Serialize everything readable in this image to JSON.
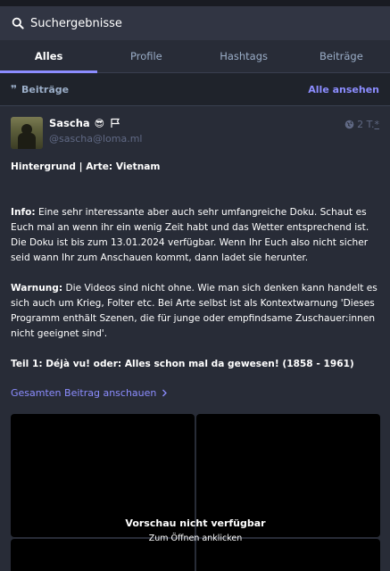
{
  "search": {
    "value": "Suchergebnisse"
  },
  "tabs": [
    {
      "label": "Alles",
      "active": true
    },
    {
      "label": "Profile",
      "active": false
    },
    {
      "label": "Hashtags",
      "active": false
    },
    {
      "label": "Beiträge",
      "active": false
    }
  ],
  "section": {
    "title": "Beiträge",
    "view_all": "Alle ansehen"
  },
  "post": {
    "display_name": "Sascha",
    "emoji": "😎",
    "acct": "@sascha@loma.ml",
    "time": "2 T.",
    "time_marker": "*",
    "title": "Hintergrund | Arte: Vietnam",
    "info_label": "Info:",
    "info_text": " Eine sehr interessante aber auch sehr umfangreiche Doku. Schaut es Euch mal an wenn ihr ein wenig Zeit habt und das Wetter entsprechend ist. Die Doku ist bis zum 13.01.2024 verfügbar. Wenn Ihr Euch also nicht sicher seid wann Ihr zum Anschauen kommt, dann ladet sie herunter.",
    "warning_label": "Warnung:",
    "warning_text": " Die Videos sind nicht ohne. Wie man sich denken kann handelt es sich auch um Krieg, Folter etc. Bei Arte selbst ist als Kontextwarnung 'Dieses Programm enthält Szenen, die für junge oder empfindsame Zuschauer:innen nicht geeignet sind'.",
    "part1": "Teil 1: Déjà vu! oder: Alles schon mal da gewesen! (1858 - 1961)",
    "read_more": "Gesamten Beitrag anschauen",
    "media": {
      "unavailable": "Vorschau nicht verfügbar",
      "click_hint": "Zum Öffnen anklicken"
    }
  },
  "colors": {
    "background": "#282c37",
    "accent": "#8c8dff",
    "muted": "#606984",
    "secondary": "#9baec8"
  }
}
